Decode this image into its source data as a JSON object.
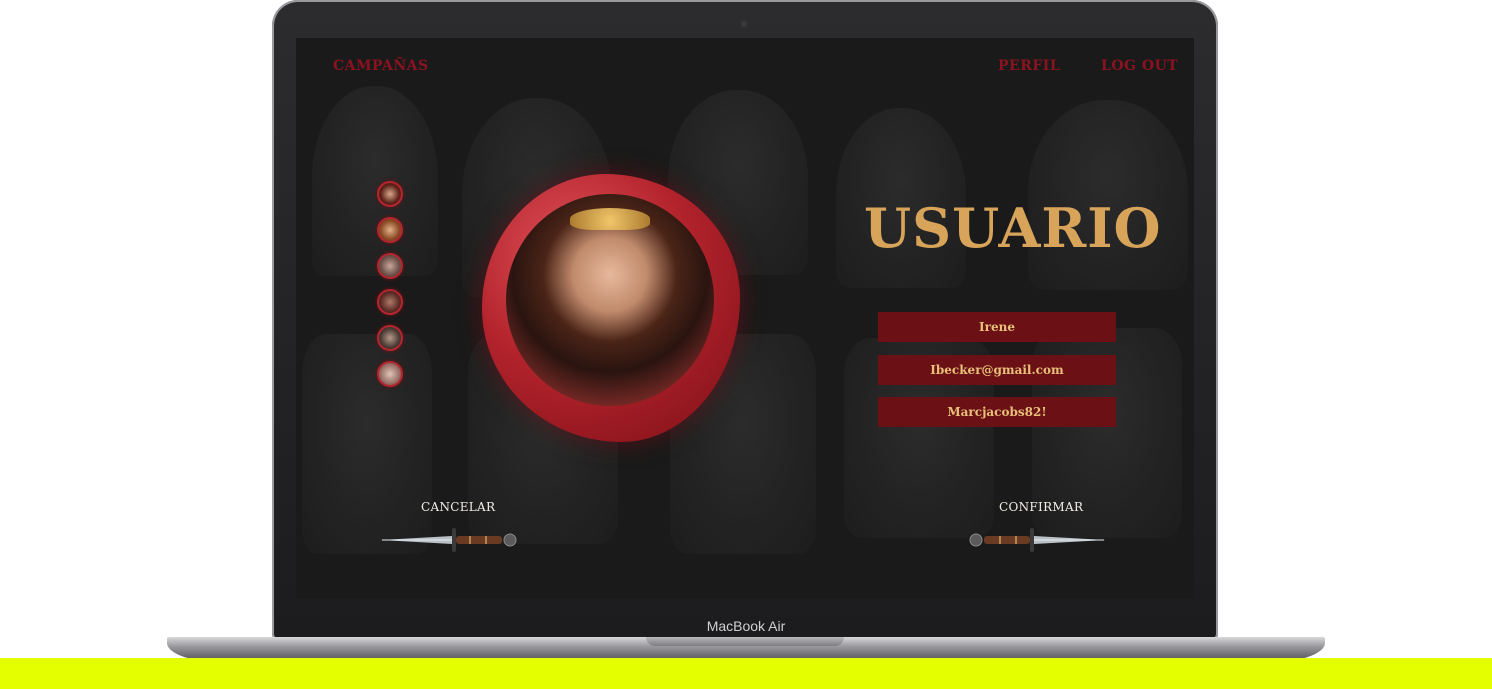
{
  "device": {
    "label": "MacBook Air"
  },
  "nav": {
    "campaigns": "CAMPAÑAS",
    "profile": "PERFIL",
    "logout": "LOG OUT"
  },
  "page": {
    "title": "USUARIO"
  },
  "avatars": [
    "avatar-1",
    "avatar-2",
    "avatar-3",
    "avatar-4",
    "avatar-5",
    "avatar-6"
  ],
  "form": {
    "name": "Irene",
    "email": "Ibecker@gmail.com",
    "password": "Marcjacobs82!"
  },
  "actions": {
    "cancel": "CANCELAR",
    "confirm": "CONFIRMAR"
  },
  "colors": {
    "accent": "#8b1320",
    "gold": "#d8a45a",
    "field_bg": "#6b1116",
    "ground": "#e3ff00"
  }
}
